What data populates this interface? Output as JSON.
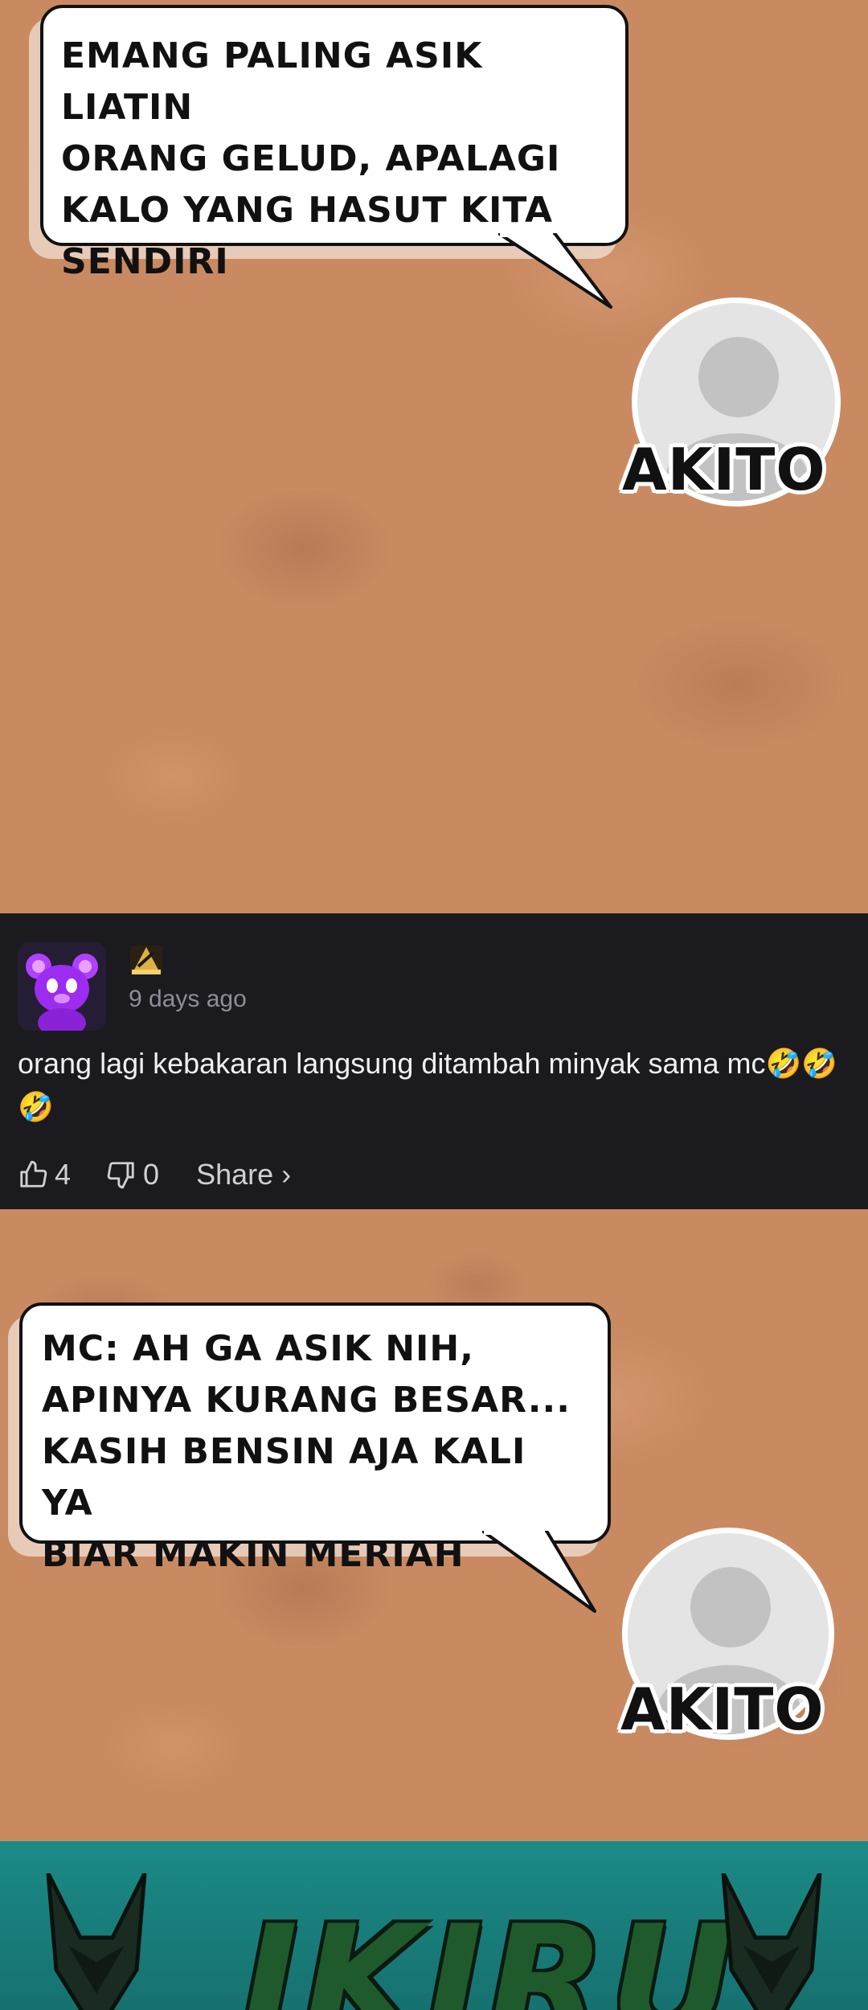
{
  "panels": [
    {
      "bubble_text": "EMANG PALING ASIK LIATIN\nORANG GELUD, APALAGI\nKALO YANG HASUT KITA\nSENDIRI",
      "speaker": "AKITO"
    },
    {
      "bubble_text": "MC: AH GA ASIK NIH,\nAPINYA KURANG BESAR...\nKASIH BENSIN AJA KALI YA\nBIAR MAKIN MERIAH",
      "speaker": "AKITO"
    }
  ],
  "comment": {
    "time": "9 days ago",
    "text": "orang lagi kebakaran langsung ditambah minyak sama mc🤣🤣🤣",
    "likes": "4",
    "dislikes": "0",
    "share_label": "Share ›",
    "avatar_icon": "purple-bear-avatar-icon",
    "badge_icon": "user-badge-icon"
  },
  "banner": {
    "text": "IKIRU",
    "icons": [
      "anubis-mask-icon",
      "anubis-mask-icon"
    ],
    "background": "#1b8a86"
  }
}
